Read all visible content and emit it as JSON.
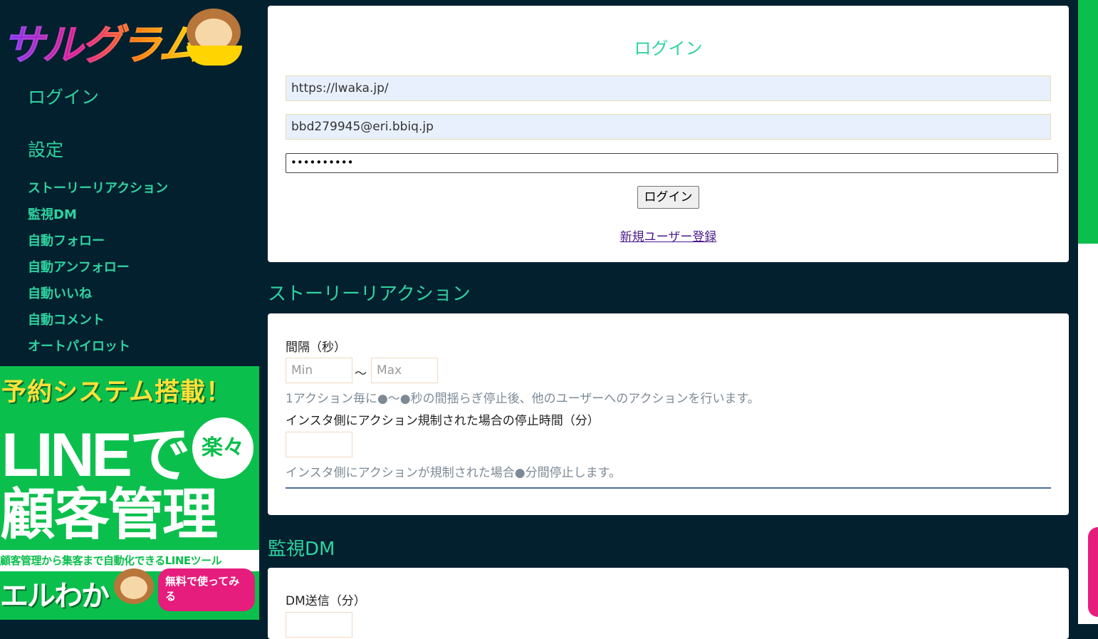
{
  "logo": {
    "text": "サルグラム"
  },
  "sidebar": {
    "login": "ログイン",
    "settings": "設定",
    "items": [
      "ストーリーリアクション",
      "監視DM",
      "自動フォロー",
      "自動アンフォロー",
      "自動いいね",
      "自動コメント",
      "オートパイロット"
    ]
  },
  "banner": {
    "headline": "予約システム搭載！",
    "line_text": "LINEで",
    "raku": "楽々",
    "kanri": "顧客管理",
    "sub": "顧客管理から集客まで自動化できるLINEツール",
    "brand": "エルわか",
    "cta": "無料で使ってみる"
  },
  "login_card": {
    "title": "ログイン",
    "url_value": "https://lwaka.jp/",
    "email_value": "bbd279945@eri.bbiq.jp",
    "password_value": "••••••••••",
    "login_button": "ログイン",
    "register_link": "新規ユーザー登録"
  },
  "story": {
    "title": "ストーリーリアクション",
    "interval_label": "間隔（秒）",
    "min_placeholder": "Min",
    "tilde": "～",
    "max_placeholder": "Max",
    "interval_help": "1アクション毎に●～●秒の間揺らぎ停止後、他のユーザーへのアクションを行います。",
    "stop_label": "インスタ側にアクション規制された場合の停止時間（分）",
    "stop_help": "インスタ側にアクションが規制された場合●分間停止します。"
  },
  "dm": {
    "title": "監視DM",
    "send_label": "DM送信（分）"
  },
  "colors": {
    "background": "#03202f",
    "accent": "#2ed3a0",
    "line_green": "#0bbf4c",
    "cta_pink": "#e61d7c"
  }
}
